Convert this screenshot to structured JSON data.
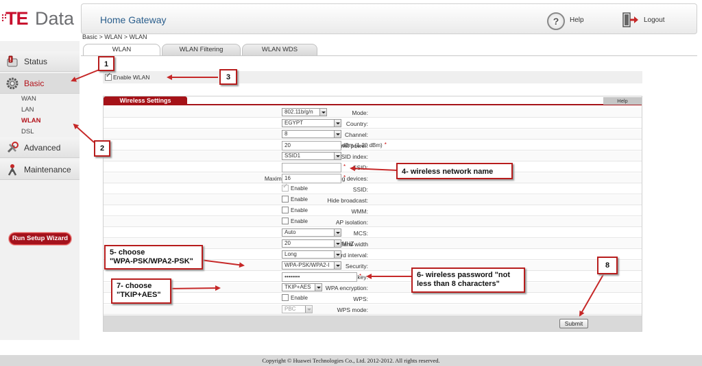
{
  "brand": {
    "logo_te": "TE",
    "logo_data": "Data"
  },
  "header": {
    "title": "Home Gateway",
    "help_label": "Help",
    "logout_label": "Logout"
  },
  "breadcrumb": "Basic > WLAN > WLAN",
  "tabs": [
    {
      "label": "WLAN",
      "active": true
    },
    {
      "label": "WLAN Filtering",
      "active": false
    },
    {
      "label": "WLAN WDS",
      "active": false
    }
  ],
  "sidebar": {
    "items": [
      {
        "label": "Status",
        "icon": "status-icon",
        "active": false
      },
      {
        "label": "Basic",
        "icon": "gear-icon",
        "active": true
      },
      {
        "label": "Advanced",
        "icon": "tools-icon",
        "active": false
      },
      {
        "label": "Maintenance",
        "icon": "wrench-icon",
        "active": false
      }
    ],
    "subitems": [
      {
        "label": "WAN",
        "active": false
      },
      {
        "label": "LAN",
        "active": false
      },
      {
        "label": "WLAN",
        "active": true
      },
      {
        "label": "DSL",
        "active": false
      }
    ],
    "wizard_label": "Run Setup Wizard"
  },
  "enable_wlan": {
    "label": "Enable WLAN",
    "checked": true
  },
  "panel": {
    "title": "Wireless Settings",
    "help_label": "Help",
    "rows": {
      "mode": {
        "label": "Mode:",
        "value": "802.11b/g/n"
      },
      "country": {
        "label": "Country:",
        "value": "EGYPT"
      },
      "channel": {
        "label": "Channel:",
        "value": "8"
      },
      "power": {
        "label": "Transmit power:",
        "value": "20",
        "unit": "dBm (1-20 dBm)",
        "required": "*"
      },
      "ssid_index": {
        "label": "SSID index:",
        "value": "SSID1"
      },
      "ssid": {
        "label": "SSID:",
        "value": "",
        "required": "*"
      },
      "max_devices": {
        "label": "Maximum number of accessing devices:",
        "value": "16",
        "required": "*"
      },
      "ssid_enable": {
        "label": "SSID:",
        "option": "Enable",
        "checked": true
      },
      "hide_broadcast": {
        "label": "Hide broadcast:",
        "option": "Enable",
        "checked": false
      },
      "wmm": {
        "label": "WMM:",
        "option": "Enable",
        "checked": false
      },
      "ap_isolation": {
        "label": "AP isolation:",
        "option": "Enable",
        "checked": false
      },
      "mcs": {
        "label": "MCS:",
        "value": "Auto"
      },
      "bandwidth": {
        "label": "Band width",
        "value": "20",
        "unit": "MHZ"
      },
      "guard": {
        "label": "Guard interval:",
        "value": "Long"
      },
      "security": {
        "label": "Security:",
        "value": "WPA-PSK/WPA2-I"
      },
      "psk": {
        "label": "WPA pre-shared key:",
        "value": "••••••••",
        "required": "*"
      },
      "encryption": {
        "label": "WPA encryption:",
        "value": "TKIP+AES"
      },
      "wps": {
        "label": "WPS:",
        "option": "Enable",
        "checked": false
      },
      "wps_mode": {
        "label": "WPS mode:",
        "value": "PBC"
      }
    },
    "submit_label": "Submit"
  },
  "annotations": {
    "n1": "1",
    "n2": "2",
    "n3": "3",
    "n8": "8",
    "a4": "4- wireless network name",
    "a5_line1": "5- choose",
    "a5_line2": "\"WPA-PSK/WPA2-PSK\"",
    "a6_line1": "6- wireless password \"not",
    "a6_line2": "less than 8 characters\"",
    "a7_line1": "7- choose",
    "a7_line2": "\"TKIP+AES\""
  },
  "footer": "Copyright © Huawei Technologies Co., Ltd. 2012-2012. All rights reserved.",
  "colors": {
    "brand_red": "#a51218",
    "title_blue": "#2a5e8c",
    "annotation_red": "#b71c1c"
  }
}
